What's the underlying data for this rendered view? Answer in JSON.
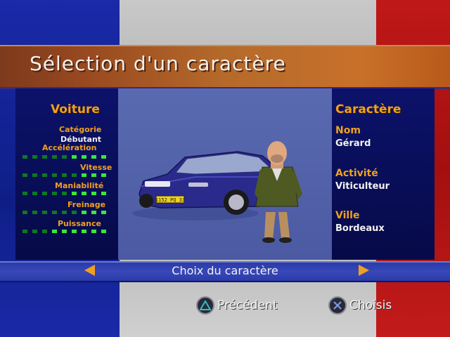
{
  "title": "Sélection d'un caractère",
  "left": {
    "header": "Voiture",
    "category_label": "Catégorie",
    "category_value": "Débutant",
    "stats": [
      {
        "label": "Accélération",
        "value": 4,
        "max": 9
      },
      {
        "label": "Vitesse",
        "value": 3,
        "max": 9
      },
      {
        "label": "Maniabilité",
        "value": 4,
        "max": 9
      },
      {
        "label": "Freinage",
        "value": 3,
        "max": 9
      },
      {
        "label": "Puissance",
        "value": 6,
        "max": 9
      }
    ]
  },
  "right": {
    "header": "Caractère",
    "fields": [
      {
        "label": "Nom",
        "value": "Gérard"
      },
      {
        "label": "Activité",
        "value": "Viticulteur"
      },
      {
        "label": "Ville",
        "value": "Bordeaux"
      }
    ]
  },
  "car": {
    "plate": "1152 PQ 33"
  },
  "selector": {
    "label": "Choix du caractère"
  },
  "buttons": {
    "previous": {
      "label": "Précédent",
      "icon": "triangle-icon"
    },
    "choose": {
      "label": "Choisis",
      "icon": "cross-icon"
    }
  },
  "colors": {
    "accent": "#f0a020",
    "bar_on": "#38e83a",
    "bar_off": "#0d7a22"
  }
}
